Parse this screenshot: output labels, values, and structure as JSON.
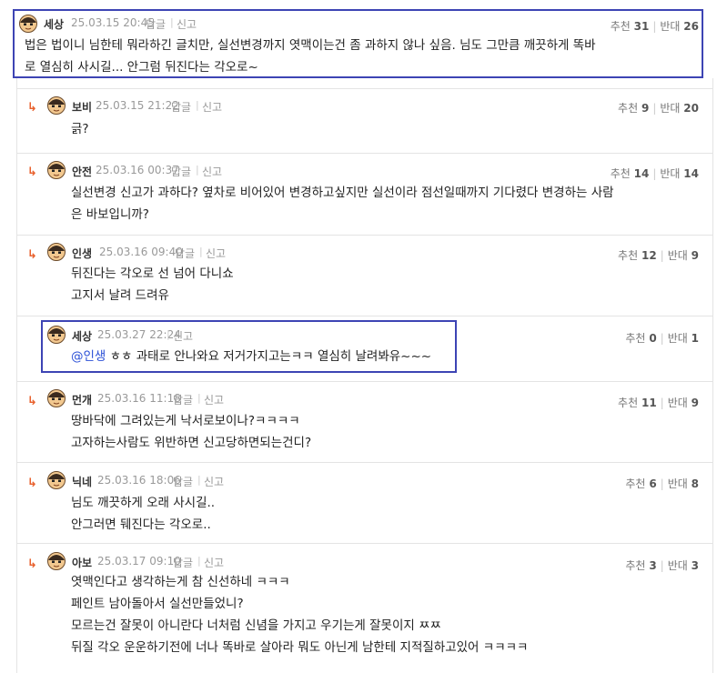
{
  "actions": {
    "reply": "답글",
    "report": "신고"
  },
  "votes": {
    "up_label": "추천",
    "down_label": "반대"
  },
  "comments": [
    {
      "nick": "세상",
      "date": "25.03.15 20:45",
      "up": "31",
      "down": "26",
      "lines": [
        "법은 법이니 님한테 뭐라하긴 글치만, 실선변경까지 엿맥이는건 좀 과하지 않나 싶음. 님도 그만큼 깨끗하게 똑바",
        "로 열심히 사시길... 안그럼 뒤진다는 각오로~"
      ],
      "highlighted": true
    },
    {
      "nick": "보비",
      "date": "25.03.15 21:22",
      "up": "9",
      "down": "20",
      "lines": [
        "긁?"
      ]
    },
    {
      "nick": "안전",
      "date": "25.03.16 00:37",
      "up": "14",
      "down": "14",
      "lines": [
        "실선변경 신고가 과하다? 옆차로 비어있어 변경하고싶지만 실선이라 점선일때까지 기다렸다 변경하는 사람",
        "은 바보입니까?"
      ]
    },
    {
      "nick": "인생",
      "date": "25.03.16 09:40",
      "up": "12",
      "down": "9",
      "lines": [
        "뒤진다는 각오로 선 넘어 다니쇼",
        "고지서 날려 드려유"
      ]
    },
    {
      "nick": "세상",
      "date": "25.03.27 22:24",
      "up": "0",
      "down": "1",
      "mention": "@인생",
      "text": " ㅎㅎ 과태로 안나와요 저거가지고는ㅋㅋ 열심히 날려봐유~~~",
      "highlighted": true
    },
    {
      "nick": "먼개",
      "date": "25.03.16 11:18",
      "up": "11",
      "down": "9",
      "lines": [
        "땅바닥에 그려있는게 낙서로보이나?ㅋㅋㅋㅋ",
        "고자하는사람도 위반하면 신고당하면되는건디?"
      ]
    },
    {
      "nick": "닉네",
      "date": "25.03.16 18:06",
      "up": "6",
      "down": "8",
      "lines": [
        "님도 깨끗하게 오래 사시길..",
        "안그러면 뒈진다는 각오로.."
      ]
    },
    {
      "nick": "아보",
      "date": "25.03.17 09:10",
      "up": "3",
      "down": "3",
      "lines": [
        "엿맥인다고 생각하는게 참 신선하네 ㅋㅋㅋ",
        "페인트 남아돌아서 실선만들었니?",
        "모르는건 잘못이 아니란다 너처럼 신념을 가지고 우기는게 잘못이지 ㅉㅉ",
        "뒤질 각오 운운하기전에 너나 똑바로 살아라 뭐도 아닌게 남한테 지적질하고있어 ㅋㅋㅋㅋ"
      ]
    }
  ]
}
